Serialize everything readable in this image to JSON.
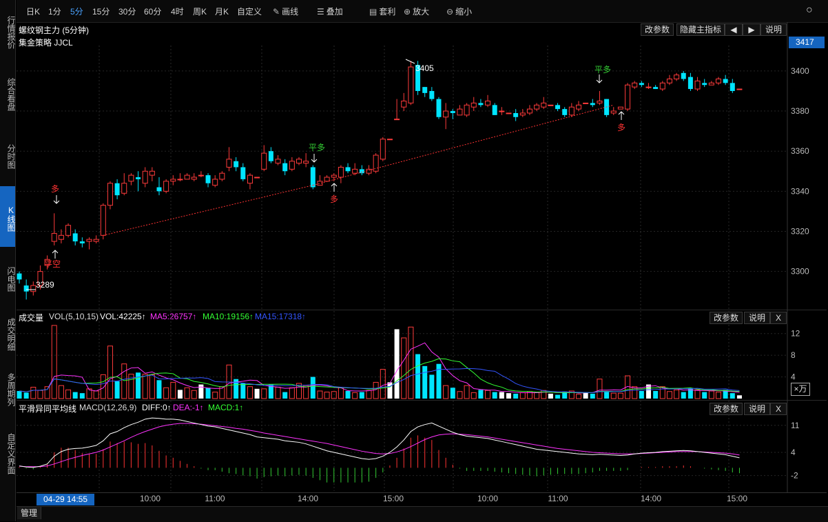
{
  "toolbar": {
    "items": [
      "日K",
      "1分",
      "5分",
      "15分",
      "30分",
      "60分",
      "4时",
      "周K",
      "月K",
      "自定义",
      "画线",
      "叠加",
      "套利",
      "放大",
      "缩小"
    ],
    "active": "5分",
    "window_close": "○"
  },
  "left_nav": [
    "行情报价",
    "综合看盘",
    "分时图",
    "K线图",
    "闪电图",
    "成交明细",
    "多周期列",
    "自定义界面"
  ],
  "left_nav_active": "K线图",
  "main_panel": {
    "title": "螺纹钢主力 (5分钟)",
    "strategy": "集金策略 JJCL",
    "buttons": [
      "改参数",
      "隐藏主指标",
      "◀",
      "▶",
      "说明"
    ],
    "price_tag": "3417",
    "high_label": "3405",
    "low_label": "3289",
    "y_ticks": [
      "3400",
      "3380",
      "3360",
      "3340",
      "3320",
      "3300"
    ],
    "signals": [
      {
        "text": "多",
        "color": "#ff3333"
      },
      {
        "text": "平空",
        "color": "#ff3333"
      },
      {
        "text": "平多",
        "color": "#33cc33"
      },
      {
        "text": "多",
        "color": "#ff3333"
      },
      {
        "text": "平多",
        "color": "#33cc33"
      },
      {
        "text": "多",
        "color": "#ff3333"
      }
    ]
  },
  "volume_panel": {
    "label": "成交量",
    "vol_label": "VOL(5,10,15)",
    "vol_value": "VOL:42225↑",
    "ma5": "MA5:26757↑",
    "ma10": "MA10:19156↑",
    "ma15": "MA15:17318↑",
    "buttons": [
      "改参数",
      "说明",
      "X"
    ],
    "y_ticks": [
      "12",
      "8",
      "4"
    ],
    "unit": "×万"
  },
  "macd_panel": {
    "label": "平滑异同平均线",
    "macd_label": "MACD(12,26,9)",
    "diff": "DIFF:0↑",
    "dea": "DEA:-1↑",
    "macd": "MACD:1↑",
    "buttons": [
      "改参数",
      "说明",
      "X"
    ],
    "y_ticks": [
      "11",
      "4",
      "-2"
    ]
  },
  "time_axis": {
    "cursor": "04-29 14:55",
    "labels": [
      "10:00",
      "11:00",
      "14:00",
      "15:00",
      "10:00",
      "11:00",
      "14:00",
      "15:00"
    ]
  },
  "bottom_bar": {
    "manage": "管理"
  },
  "colors": {
    "up": "#ff3b3b",
    "down": "#00e5ff",
    "ma5": "#ff33ff",
    "ma10": "#33ff33",
    "ma15": "#3355ff",
    "dea": "#ff33ff",
    "macd_label": "#33ff33",
    "accent": "#1565c0"
  },
  "chart_data": {
    "type": "candlestick",
    "title": "螺纹钢主力 (5分钟)",
    "ylim": [
      3282,
      3412
    ],
    "candles": [
      [
        3299,
        3296,
        3300,
        3294
      ],
      [
        3293,
        3290,
        3296,
        3286
      ],
      [
        3290,
        3293,
        3295,
        3288
      ],
      [
        3293,
        3300,
        3303,
        3291
      ],
      [
        3303,
        3306,
        3308,
        3301
      ],
      [
        3315,
        3319,
        3329,
        3313
      ],
      [
        3316,
        3318,
        3321,
        3314
      ],
      [
        3318,
        3323,
        3324,
        3317
      ],
      [
        3319,
        3315,
        3321,
        3313
      ],
      [
        3315,
        3314,
        3317,
        3312
      ],
      [
        3315,
        3316,
        3317,
        3311
      ],
      [
        3315,
        3316,
        3318,
        3314
      ],
      [
        3318,
        3333,
        3334,
        3316
      ],
      [
        3333,
        3344,
        3345,
        3331
      ],
      [
        3344,
        3338,
        3346,
        3336
      ],
      [
        3339,
        3344,
        3349,
        3338
      ],
      [
        3345,
        3348,
        3349,
        3343
      ],
      [
        3347,
        3346,
        3350,
        3340
      ],
      [
        3344,
        3350,
        3352,
        3342
      ],
      [
        3348,
        3350,
        3352,
        3345
      ],
      [
        3342,
        3340,
        3347,
        3338
      ],
      [
        3340,
        3345,
        3346,
        3339
      ],
      [
        3345,
        3346,
        3348,
        3343
      ],
      [
        3346,
        3346,
        3349,
        3345
      ],
      [
        3346,
        3348,
        3349,
        3346
      ],
      [
        3346,
        3347,
        3349,
        3345
      ],
      [
        3348,
        3348,
        3350,
        3347
      ],
      [
        3348,
        3344,
        3349,
        3342
      ],
      [
        3343,
        3346,
        3348,
        3342
      ],
      [
        3346,
        3349,
        3350,
        3345
      ],
      [
        3352,
        3356,
        3362,
        3350
      ],
      [
        3355,
        3352,
        3357,
        3350
      ],
      [
        3352,
        3346,
        3354,
        3345
      ],
      [
        3344,
        3348,
        3349,
        3341
      ],
      [
        3347,
        3347,
        3347,
        3347
      ],
      [
        3351,
        3359,
        3363,
        3350
      ],
      [
        3360,
        3355,
        3362,
        3354
      ],
      [
        3354,
        3356,
        3358,
        3353
      ],
      [
        3354,
        3350,
        3356,
        3348
      ],
      [
        3351,
        3355,
        3357,
        3350
      ],
      [
        3354,
        3356,
        3357,
        3353
      ],
      [
        3354,
        3355,
        3359,
        3352
      ],
      [
        3352,
        3342,
        3353,
        3341
      ],
      [
        3343,
        3345,
        3348,
        3343
      ],
      [
        3345,
        3347,
        3348,
        3345
      ],
      [
        3347,
        3348,
        3349,
        3345
      ],
      [
        3347,
        3352,
        3353,
        3344
      ],
      [
        3352,
        3350,
        3354,
        3349
      ],
      [
        3349,
        3351,
        3354,
        3348
      ],
      [
        3351,
        3349,
        3353,
        3348
      ],
      [
        3349,
        3351,
        3353,
        3348
      ],
      [
        3350,
        3358,
        3359,
        3349
      ],
      [
        3356,
        3366,
        3367,
        3355
      ],
      [
        3366,
        3366,
        3366,
        3366
      ],
      [
        3376,
        3376,
        3386,
        3376
      ],
      [
        3382,
        3385,
        3389,
        3380
      ],
      [
        3384,
        3402,
        3405,
        3383
      ],
      [
        3403,
        3390,
        3405,
        3388
      ],
      [
        3392,
        3389,
        3392,
        3387
      ],
      [
        3390,
        3386,
        3392,
        3385
      ],
      [
        3386,
        3377,
        3387,
        3376
      ],
      [
        3377,
        3380,
        3384,
        3371
      ],
      [
        3380,
        3379,
        3381,
        3376
      ],
      [
        3378,
        3381,
        3383,
        3378
      ],
      [
        3378,
        3383,
        3384,
        3377
      ],
      [
        3382,
        3384,
        3387,
        3380
      ],
      [
        3384,
        3383,
        3386,
        3382
      ],
      [
        3383,
        3385,
        3388,
        3382
      ],
      [
        3383,
        3378,
        3384,
        3378
      ],
      [
        3380,
        3380,
        3382,
        3378
      ],
      [
        3379,
        3379,
        3379,
        3379
      ],
      [
        3379,
        3377,
        3381,
        3375
      ],
      [
        3378,
        3379,
        3381,
        3377
      ],
      [
        3379,
        3381,
        3383,
        3378
      ],
      [
        3381,
        3383,
        3384,
        3380
      ],
      [
        3382,
        3384,
        3387,
        3381
      ],
      [
        3383,
        3383,
        3383,
        3383
      ],
      [
        3383,
        3381,
        3384,
        3380
      ],
      [
        3381,
        3378,
        3382,
        3377
      ],
      [
        3378,
        3382,
        3384,
        3377
      ],
      [
        3381,
        3383,
        3385,
        3380
      ],
      [
        3384,
        3384,
        3384,
        3384
      ],
      [
        3384,
        3383,
        3386,
        3382
      ],
      [
        3384,
        3385,
        3390,
        3383
      ],
      [
        3386,
        3378,
        3386,
        3377
      ],
      [
        3379,
        3380,
        3382,
        3378
      ],
      [
        3381,
        3382,
        3382,
        3381
      ],
      [
        3381,
        3393,
        3394,
        3380
      ],
      [
        3392,
        3394,
        3395,
        3391
      ],
      [
        3394,
        3393,
        3395,
        3392
      ],
      [
        3392,
        3392,
        3394,
        3391
      ],
      [
        3392,
        3391,
        3393,
        3391
      ],
      [
        3391,
        3394,
        3395,
        3390
      ],
      [
        3394,
        3396,
        3398,
        3393
      ],
      [
        3396,
        3398,
        3399,
        3395
      ],
      [
        3399,
        3396,
        3400,
        3395
      ],
      [
        3397,
        3391,
        3399,
        3390
      ],
      [
        3391,
        3395,
        3397,
        3390
      ],
      [
        3394,
        3393,
        3396,
        3392
      ],
      [
        3393,
        3394,
        3395,
        3393
      ],
      [
        3394,
        3396,
        3397,
        3393
      ],
      [
        3396,
        3394,
        3398,
        3393
      ],
      [
        3394,
        3390,
        3396,
        3389
      ],
      [
        3391,
        3391,
        3391,
        3391
      ]
    ],
    "volume_ylim": [
      0,
      14
    ],
    "volume": [
      1.4,
      1.1,
      2.1,
      1.5,
      2.2,
      13.5,
      2.4,
      1.6,
      1.2,
      1.0,
      1.8,
      1.4,
      4.4,
      9.7,
      3.2,
      6.4,
      4.5,
      4.8,
      4.5,
      4.4,
      3.4,
      2.0,
      3.0,
      1.6,
      2.0,
      1.5,
      2.6,
      2.0,
      1.2,
      2.2,
      6.2,
      3.6,
      2.8,
      2.2,
      1.8,
      1.8,
      2.6,
      2.1,
      1.2,
      2.0,
      2.8,
      2.4,
      4.0,
      1.4,
      1.2,
      1.3,
      2.0,
      1.4,
      1.1,
      1.2,
      1.5,
      3.0,
      5.4,
      3.0,
      12.8,
      11.2,
      13.2,
      8.2,
      6.0,
      4.4,
      6.4,
      2.4,
      2.0,
      1.3,
      2.4,
      1.1,
      1.6,
      1.5,
      1.2,
      1.2,
      1.0,
      0.9,
      1.1,
      1.3,
      1.1,
      1.5,
      0.9,
      0.7,
      1.3,
      1.4,
      0.8,
      1.1,
      0.9,
      3.6,
      1.4,
      1.0,
      1.0,
      4.2,
      2.2,
      1.4,
      2.6,
      1.4,
      2.2,
      1.3,
      1.6,
      1.2,
      1.8,
      1.6,
      1.2,
      1.4,
      1.2,
      1.6,
      1.0,
      0.6
    ],
    "macd_ylim": [
      -6,
      14
    ],
    "diff": [
      0.5,
      0.2,
      0.1,
      0.4,
      1.0,
      3.0,
      4.2,
      4.8,
      5.0,
      5.1,
      5.4,
      5.8,
      7.0,
      8.8,
      9.4,
      10.4,
      11.2,
      11.8,
      12.6,
      12.9,
      12.8,
      12.6,
      12.6,
      12.4,
      12.0,
      11.6,
      11.2,
      10.8,
      10.6,
      10.2,
      9.8,
      9.4,
      9.0,
      8.6,
      8.0,
      7.8,
      7.6,
      7.4,
      7.0,
      6.8,
      6.6,
      6.2,
      5.6,
      5.0,
      4.4,
      4.0,
      3.6,
      3.2,
      2.8,
      2.4,
      2.2,
      2.4,
      3.0,
      4.0,
      5.4,
      7.2,
      9.4,
      10.6,
      11.2,
      11.6,
      10.8,
      10.0,
      9.2,
      8.6,
      8.2,
      8.0,
      7.8,
      7.6,
      7.2,
      6.8,
      6.4,
      6.0,
      5.6,
      5.2,
      4.8,
      4.6,
      4.4,
      4.2,
      4.0,
      3.8,
      3.6,
      3.5,
      3.4,
      3.5,
      3.4,
      3.3,
      3.2,
      3.3,
      3.6,
      3.8,
      3.9,
      4.0,
      4.2,
      4.3,
      4.4,
      4.5,
      4.4,
      4.2,
      4.0,
      3.8,
      3.6,
      3.4,
      3.0,
      2.6
    ],
    "dea": [
      0.4,
      0.3,
      0.3,
      0.3,
      0.5,
      1.0,
      1.6,
      2.2,
      2.7,
      3.2,
      3.6,
      4.0,
      4.6,
      5.4,
      6.2,
      7.0,
      7.9,
      8.7,
      9.4,
      10.0,
      10.6,
      11.0,
      11.3,
      11.5,
      11.5,
      11.4,
      11.3,
      11.1,
      10.9,
      10.7,
      10.5,
      10.2,
      10.0,
      9.7,
      9.4,
      9.0,
      8.7,
      8.4,
      8.1,
      7.8,
      7.5,
      7.2,
      6.9,
      6.6,
      6.3,
      5.9,
      5.5,
      5.1,
      4.7,
      4.3,
      4.0,
      3.7,
      3.6,
      3.7,
      4.1,
      4.7,
      5.5,
      6.4,
      7.3,
      8.0,
      8.5,
      8.7,
      8.8,
      8.7,
      8.6,
      8.4,
      8.2,
      8.0,
      7.7,
      7.4,
      7.1,
      6.8,
      6.5,
      6.2,
      5.9,
      5.6,
      5.3,
      5.0,
      4.8,
      4.6,
      4.4,
      4.2,
      4.0,
      3.9,
      3.8,
      3.7,
      3.6,
      3.6,
      3.6,
      3.7,
      3.8,
      3.9,
      4.0,
      4.1,
      4.2,
      4.2,
      4.2,
      4.2,
      4.1,
      4.0,
      3.9,
      3.8,
      3.6,
      3.3
    ]
  }
}
